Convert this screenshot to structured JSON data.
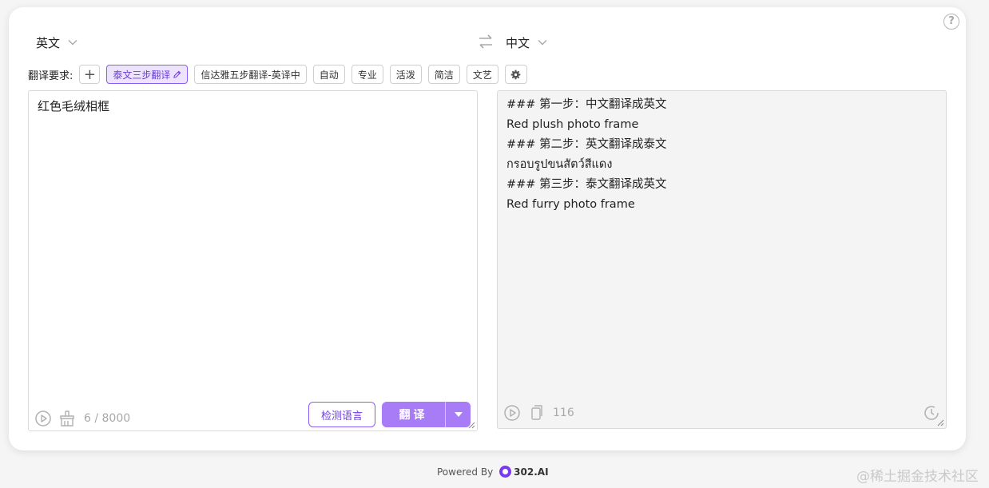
{
  "help_icon_glyph": "?",
  "source_lang": "英文",
  "target_lang": "中文",
  "requirements": {
    "label": "翻译要求:",
    "add_glyph": "+",
    "chips": [
      "泰文三步翻译",
      "信达雅五步翻译-英译中",
      "自动",
      "专业",
      "活泼",
      "简洁",
      "文艺"
    ],
    "active_chip": "泰文三步翻译"
  },
  "source": {
    "text": "红色毛绒相框",
    "count": "6 / 8000",
    "detect_label": "检测语言",
    "translate_label": "翻译"
  },
  "output": {
    "lines": [
      "### 第一步：中文翻译成英文",
      "Red plush photo frame",
      "### 第二步：英文翻译成泰文",
      "กรอบรูปขนสัตว์สีแดง",
      "### 第三步：泰文翻译成英文",
      "Red furry photo frame"
    ],
    "count": "116"
  },
  "footer": {
    "powered_by": "Powered By",
    "brand": "302.AI"
  },
  "watermark": "@稀土掘金技术社区",
  "colors": {
    "accent": "#8a5cf6",
    "button_fill": "#a77cf6",
    "chip_active_bg": "#ede3ff"
  }
}
